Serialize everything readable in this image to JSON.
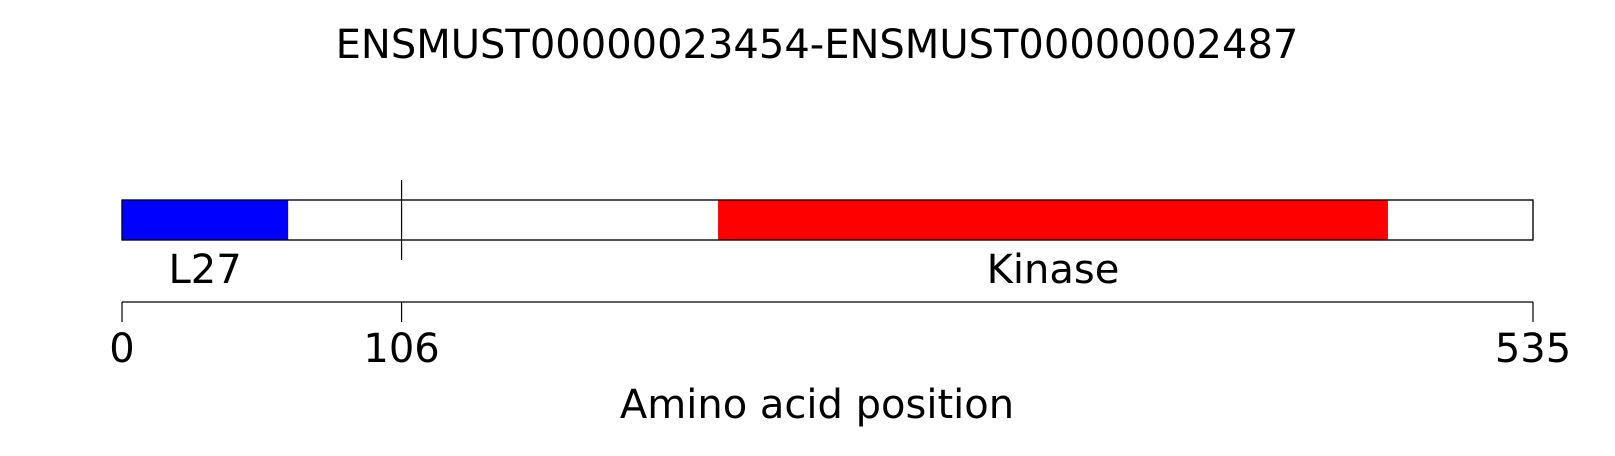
{
  "title": "ENSMUST00000023454-ENSMUST00000002487",
  "xlabel": "Amino acid position",
  "protein": {
    "length": 535,
    "border_color": "#000000",
    "fill_color": "#ffffff"
  },
  "chart_data": {
    "type": "protein-domain-map",
    "xlim": [
      0,
      535
    ],
    "ticks": [
      0,
      106,
      535
    ],
    "tick_labels": [
      "0",
      "106",
      "535"
    ],
    "breakpoint": 106,
    "domains": [
      {
        "name": "L27",
        "start": 0,
        "end": 63,
        "color": "#0000ff"
      },
      {
        "name": "Kinase",
        "start": 226,
        "end": 480,
        "color": "#ff0000"
      }
    ]
  }
}
